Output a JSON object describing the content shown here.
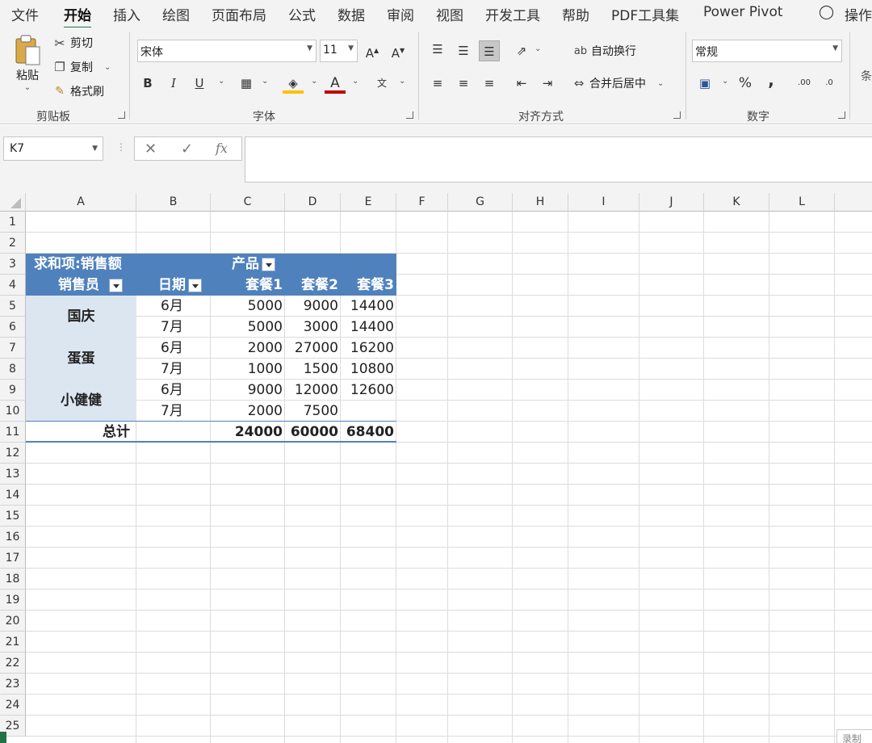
{
  "tabs": [
    "文件",
    "开始",
    "插入",
    "绘图",
    "页面布局",
    "公式",
    "数据",
    "审阅",
    "视图",
    "开发工具",
    "帮助",
    "PDF工具集",
    "Power Pivot",
    "操作"
  ],
  "ribbon": {
    "clipboard": {
      "paste": "粘贴",
      "cut": "剪切",
      "copy": "复制",
      "format_painter": "格式刷",
      "label": "剪贴板"
    },
    "font": {
      "name": "宋体",
      "size": "11",
      "bold": "B",
      "italic": "I",
      "underline": "U",
      "label": "字体"
    },
    "alignment": {
      "wrap": "自动换行",
      "merge": "合并后居中",
      "label": "对齐方式"
    },
    "number": {
      "format": "常规",
      "percent": "%",
      "comma": ",",
      "label": "数字"
    },
    "partial": "条"
  },
  "formula_bar": {
    "name_box": "K7",
    "fx": "fx",
    "value": ""
  },
  "grid": {
    "columns": [
      "A",
      "B",
      "C",
      "D",
      "E",
      "F",
      "G",
      "H",
      "I",
      "J",
      "K",
      "L"
    ],
    "rows": [
      "1",
      "2",
      "3",
      "4",
      "5",
      "6",
      "7",
      "8",
      "9",
      "10",
      "11",
      "12",
      "13",
      "14",
      "15",
      "16",
      "17",
      "18",
      "19",
      "20",
      "21",
      "22",
      "23",
      "24",
      "25"
    ]
  },
  "pivot": {
    "title": "求和项:销售额",
    "col_field": "产品",
    "row_field1": "销售员",
    "row_field2": "日期",
    "col_headers": [
      "套餐1",
      "套餐2",
      "套餐3"
    ],
    "groups": [
      {
        "name": "国庆",
        "rows": [
          {
            "date": "6月",
            "v": [
              "5000",
              "9000",
              "14400"
            ]
          },
          {
            "date": "7月",
            "v": [
              "5000",
              "3000",
              "14400"
            ]
          }
        ]
      },
      {
        "name": "蛋蛋",
        "rows": [
          {
            "date": "6月",
            "v": [
              "2000",
              "27000",
              "16200"
            ]
          },
          {
            "date": "7月",
            "v": [
              "1000",
              "1500",
              "10800"
            ]
          }
        ]
      },
      {
        "name": "小健健",
        "rows": [
          {
            "date": "6月",
            "v": [
              "9000",
              "12000",
              "12600"
            ]
          },
          {
            "date": "7月",
            "v": [
              "2000",
              "7500",
              ""
            ]
          }
        ]
      }
    ],
    "total_label": "总计",
    "totals": [
      "24000",
      "60000",
      "68400"
    ]
  },
  "status_fragment": "录制"
}
